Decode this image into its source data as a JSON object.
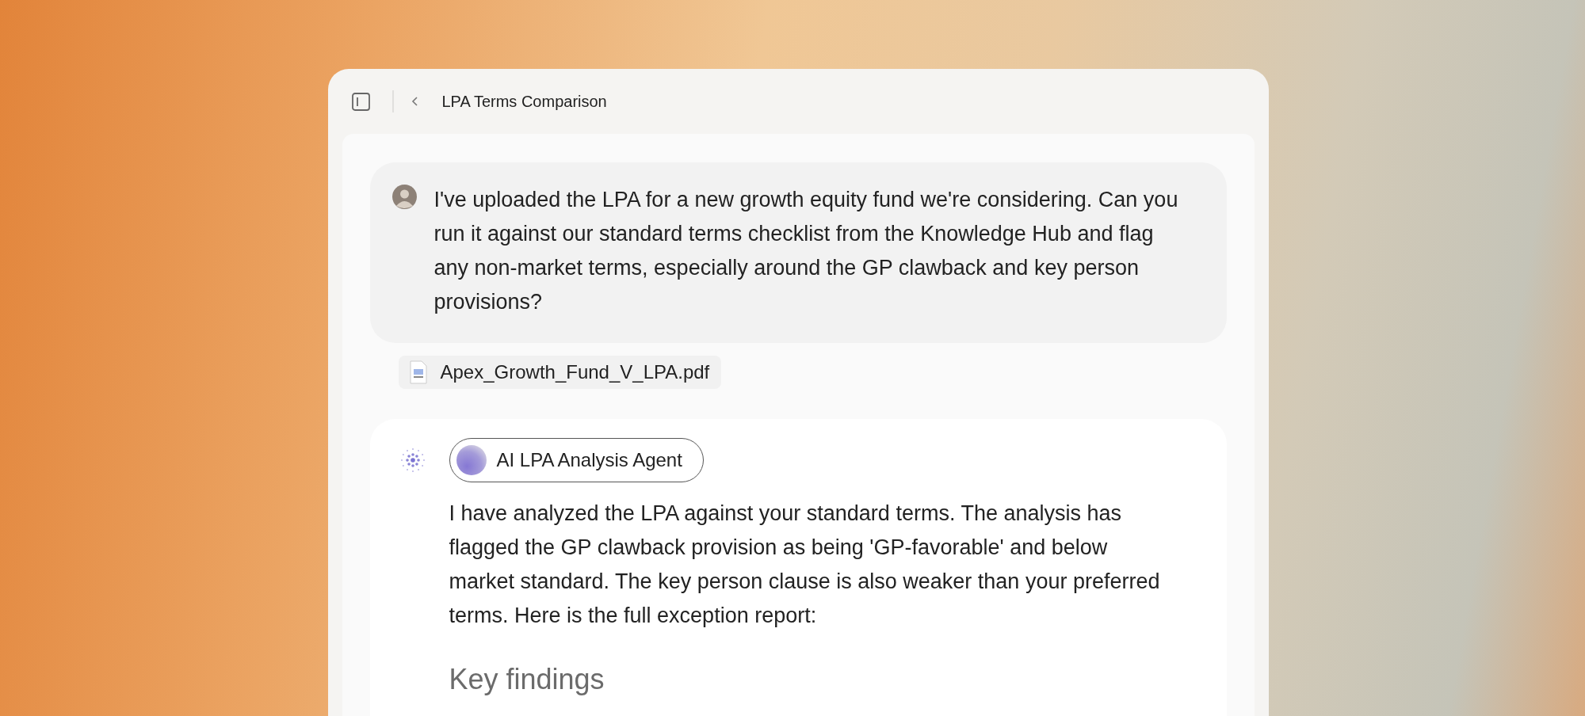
{
  "window": {
    "title": "LPA Terms Comparison"
  },
  "user_message": {
    "text": "I've uploaded the LPA for a new growth equity fund we're considering. Can you run it against our standard terms checklist from the Knowledge Hub and flag any non-market terms, especially around the GP clawback and key person provisions?",
    "attachment": "Apex_Growth_Fund_V_LPA.pdf"
  },
  "agent_message": {
    "agent_name": "AI LPA Analysis Agent",
    "text": "I have analyzed the LPA against your standard terms. The analysis has flagged the GP clawback provision as being 'GP-favorable' and below market standard. The key person clause is also weaker than your preferred terms. Here is the full exception report:",
    "heading": "Key findings"
  }
}
